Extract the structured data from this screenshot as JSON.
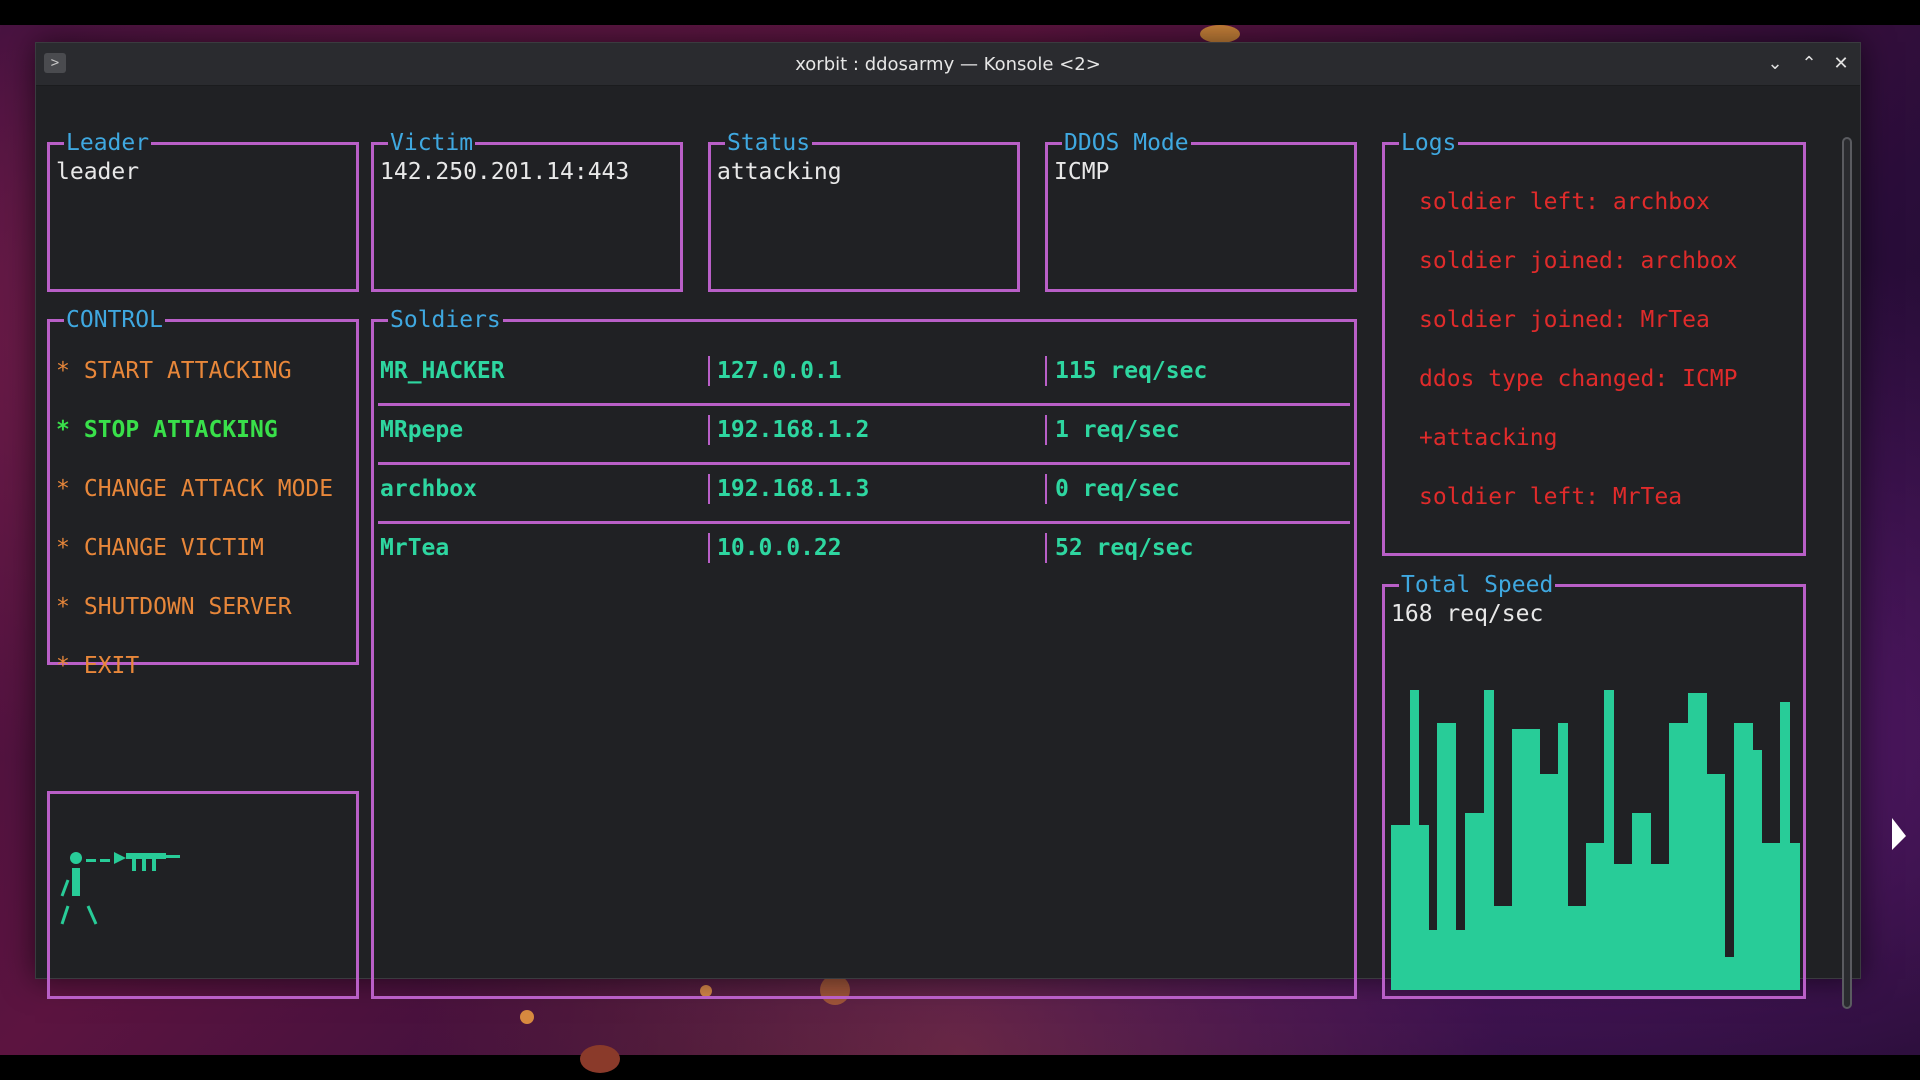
{
  "window": {
    "title": "xorbit : ddosarmy — Konsole <2>",
    "icons": [
      "terminal-icon",
      "chevron-down-icon",
      "chevron-up-icon",
      "close-icon"
    ]
  },
  "leader": {
    "label": "Leader",
    "value": "leader"
  },
  "victim": {
    "label": "Victim",
    "value": "142.250.201.14:443"
  },
  "status": {
    "label": "Status",
    "value": "attacking"
  },
  "ddos_mode": {
    "label": "DDOS Mode",
    "value": "ICMP"
  },
  "control": {
    "label": "CONTROL",
    "items": [
      {
        "label": "START ATTACKING"
      },
      {
        "label": "STOP ATTACKING"
      },
      {
        "label": "CHANGE ATTACK MODE"
      },
      {
        "label": "CHANGE VICTIM"
      },
      {
        "label": "SHUTDOWN SERVER"
      },
      {
        "label": "EXIT"
      }
    ]
  },
  "soldiers": {
    "label": "Soldiers",
    "rows": [
      {
        "name": "MR_HACKER",
        "ip": "127.0.0.1",
        "rate": "115 req/sec"
      },
      {
        "name": "MRpepe",
        "ip": "192.168.1.2",
        "rate": "1 req/sec"
      },
      {
        "name": "archbox",
        "ip": "192.168.1.3",
        "rate": "0 req/sec"
      },
      {
        "name": "MrTea",
        "ip": "10.0.0.22",
        "rate": "52 req/sec"
      }
    ]
  },
  "logs": {
    "label": "Logs",
    "entries": [
      "soldier left: archbox",
      "soldier joined: archbox",
      "soldier joined: MrTea",
      "ddos type changed: ICMP",
      "+attacking",
      "soldier left: MrTea"
    ]
  },
  "total_speed": {
    "label": "Total Speed",
    "value": "168 req/sec",
    "bar_levels": [
      0.55,
      0.55,
      1.0,
      0.55,
      0.2,
      0.89,
      0.89,
      0.2,
      0.59,
      0.59,
      1.0,
      0.28,
      0.28,
      0.87,
      0.87,
      0.87,
      0.72,
      0.72,
      0.89,
      0.28,
      0.28,
      0.49,
      0.49,
      1.0,
      0.42,
      0.42,
      0.59,
      0.59,
      0.42,
      0.42,
      0.89,
      0.89,
      0.99,
      0.99,
      0.72,
      0.72,
      0.11,
      0.89,
      0.89,
      0.8,
      0.49,
      0.49,
      0.96,
      0.49
    ]
  },
  "colors": {
    "border": "#b95fc7",
    "label": "#3fa8e0",
    "control": "#e8873a",
    "control_active": "#39e04a",
    "soldier_text": "#2ed6a0",
    "log_text": "#e02b2b",
    "chart_fill": "#28cc98"
  }
}
